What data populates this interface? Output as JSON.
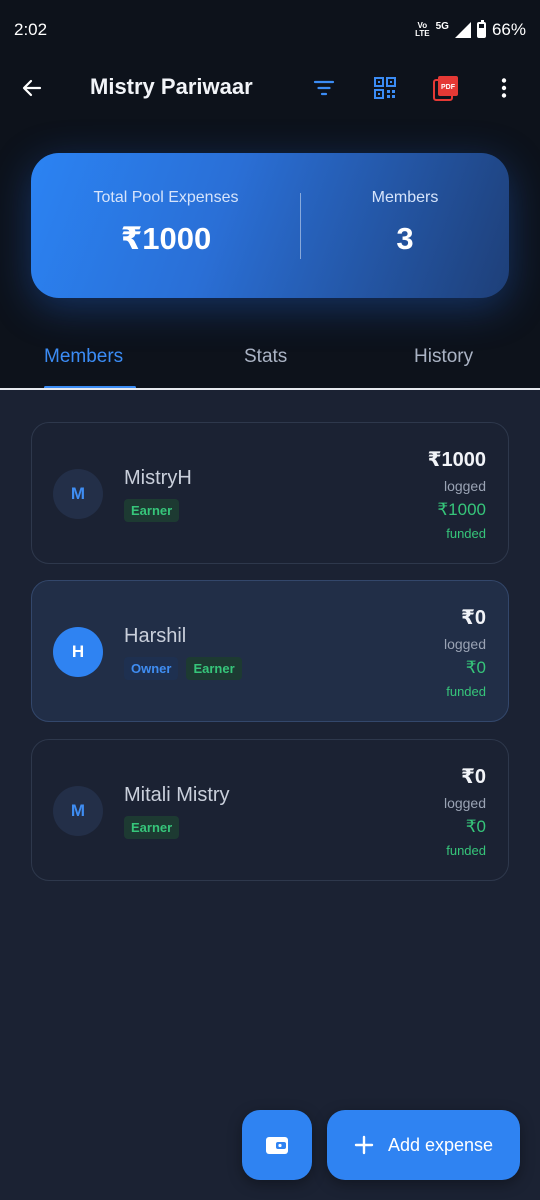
{
  "status_bar": {
    "time": "2:02",
    "volte": "Vo LTE",
    "network": "5G",
    "battery": "66%"
  },
  "app_bar": {
    "title": "Mistry Pariwaar"
  },
  "summary": {
    "total_label": "Total Pool Expenses",
    "total_value": "₹1000",
    "members_label": "Members",
    "members_value": "3"
  },
  "tabs": [
    {
      "label": "Members",
      "active": true
    },
    {
      "label": "Stats",
      "active": false
    },
    {
      "label": "History",
      "active": false
    }
  ],
  "members": [
    {
      "initial": "M",
      "name": "MistryH",
      "badges": [
        "Earner"
      ],
      "logged": "₹1000",
      "logged_label": "logged",
      "funded": "₹1000",
      "funded_label": "funded",
      "highlighted": false
    },
    {
      "initial": "H",
      "name": "Harshil",
      "badges": [
        "Owner",
        "Earner"
      ],
      "logged": "₹0",
      "logged_label": "logged",
      "funded": "₹0",
      "funded_label": "funded",
      "highlighted": true
    },
    {
      "initial": "M",
      "name": "Mitali Mistry",
      "badges": [
        "Earner"
      ],
      "logged": "₹0",
      "logged_label": "logged",
      "funded": "₹0",
      "funded_label": "funded",
      "highlighted": false
    }
  ],
  "fab": {
    "add_label": "Add expense"
  },
  "colors": {
    "accent": "#2f83f2",
    "background": "#1b2233",
    "header": "#0d121b",
    "success": "#36c57a"
  }
}
